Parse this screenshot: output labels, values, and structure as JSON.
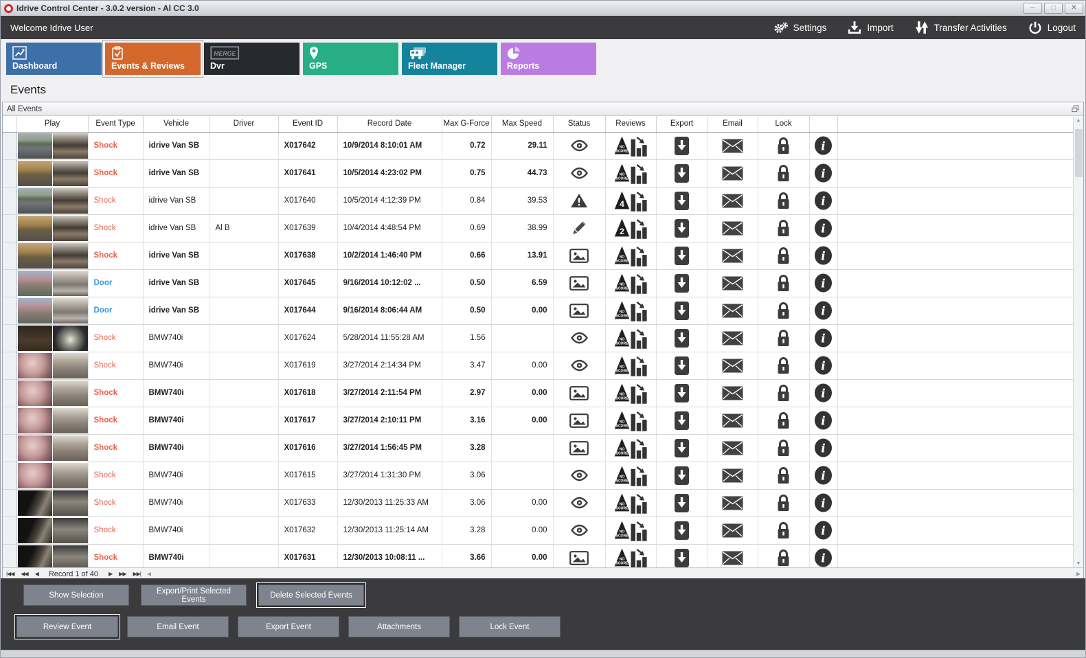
{
  "window": {
    "title": "Idrive Control Center - 3.0.2 version - Al CC 3.0",
    "controls": [
      {
        "name": "minimize"
      },
      {
        "name": "maximize"
      },
      {
        "name": "close"
      }
    ]
  },
  "topbar": {
    "welcome": "Welcome Idrive User",
    "actions": [
      {
        "name": "settings",
        "icon": "gears",
        "label": "Settings"
      },
      {
        "name": "import",
        "icon": "import",
        "label": "Import"
      },
      {
        "name": "transfer-activities",
        "icon": "transfer",
        "label": "Transfer Activities"
      },
      {
        "name": "logout",
        "icon": "power",
        "label": "Logout"
      }
    ]
  },
  "tabs": [
    {
      "name": "dashboard",
      "label": "Dashboard",
      "color": "#3d6fa8",
      "icon": "chart",
      "selected": false
    },
    {
      "name": "events-reviews",
      "label": "Events & Reviews",
      "color": "#d4682c",
      "icon": "clipboard",
      "selected": true
    },
    {
      "name": "dvr",
      "label": "Dvr",
      "color": "#26292d",
      "icon": "merge",
      "selected": false
    },
    {
      "name": "gps",
      "label": "GPS",
      "color": "#27ae85",
      "icon": "pin",
      "selected": false
    },
    {
      "name": "fleet-manager",
      "label": "Fleet Manager",
      "color": "#13849b",
      "icon": "fleet",
      "selected": false
    },
    {
      "name": "reports",
      "label": "Reports",
      "color": "#bb7ce2",
      "icon": "pie",
      "selected": false
    }
  ],
  "page": {
    "title": "Events",
    "panel_title": "All Events"
  },
  "table": {
    "columns": [
      "",
      "Play",
      "Event Type",
      "Vehicle",
      "Driver",
      "Event ID",
      "Record Date",
      "Max G-Force",
      "Max Speed",
      "Status",
      "Reviews",
      "Export",
      "Email",
      "Lock",
      ""
    ],
    "event_type_colors": {
      "Shock": "#e8614c",
      "Door": "#3a99dc"
    },
    "rows": [
      {
        "event_type": "Shock",
        "bold": true,
        "vehicle": "idrive Van SB",
        "driver": "",
        "event_id": "X017642",
        "record_date": "10/9/2014 8:10:01 AM",
        "max_g_force": "0.72",
        "max_speed": "29.11",
        "status": "viewed",
        "review": "NO SCORE",
        "thumb": "road"
      },
      {
        "event_type": "Shock",
        "bold": true,
        "vehicle": "idrive Van SB",
        "driver": "",
        "event_id": "X017641",
        "record_date": "10/5/2014 4:23:02 PM",
        "max_g_force": "0.75",
        "max_speed": "44.73",
        "status": "viewed",
        "review": "NO SCORE",
        "thumb": "autumn"
      },
      {
        "event_type": "Shock",
        "bold": false,
        "vehicle": "idrive Van SB",
        "driver": "",
        "event_id": "X017640",
        "record_date": "10/5/2014 4:12:39 PM",
        "max_g_force": "0.84",
        "max_speed": "39.53",
        "status": "warning",
        "review": "4",
        "thumb": "road"
      },
      {
        "event_type": "Shock",
        "bold": false,
        "vehicle": "idrive Van SB",
        "driver": "Al B",
        "event_id": "X017639",
        "record_date": "10/4/2014 4:48:54 PM",
        "max_g_force": "0.69",
        "max_speed": "38.99",
        "status": "edited",
        "review": "2",
        "thumb": "autumn"
      },
      {
        "event_type": "Shock",
        "bold": true,
        "vehicle": "idrive Van SB",
        "driver": "",
        "event_id": "X017638",
        "record_date": "10/2/2014 1:46:40 PM",
        "max_g_force": "0.66",
        "max_speed": "13.91",
        "status": "snapshot",
        "review": "NO SCORE",
        "thumb": "autumn"
      },
      {
        "event_type": "Door",
        "bold": true,
        "vehicle": "idrive Van SB",
        "driver": "",
        "event_id": "X017645",
        "record_date": "9/16/2014 10:12:02 ...",
        "max_g_force": "0.50",
        "max_speed": "6.59",
        "status": "snapshot",
        "review": "NO SCORE",
        "thumb": "trees"
      },
      {
        "event_type": "Door",
        "bold": true,
        "vehicle": "idrive Van SB",
        "driver": "",
        "event_id": "X017644",
        "record_date": "9/16/2014 8:06:44 AM",
        "max_g_force": "0.50",
        "max_speed": "0.00",
        "status": "snapshot",
        "review": "NO SCORE",
        "thumb": "trees"
      },
      {
        "event_type": "Shock",
        "bold": false,
        "vehicle": "BMW740i",
        "driver": "",
        "event_id": "X017624",
        "record_date": "5/28/2014 11:55:28 AM",
        "max_g_force": "1.56",
        "max_speed": "",
        "status": "viewed",
        "review": "NO SCORE",
        "thumb": "darkroom"
      },
      {
        "event_type": "Shock",
        "bold": false,
        "vehicle": "BMW740i",
        "driver": "",
        "event_id": "X017619",
        "record_date": "3/27/2014 2:14:34 PM",
        "max_g_force": "3.47",
        "max_speed": "0.00",
        "status": "viewed",
        "review": "NO SCORE",
        "thumb": "pink"
      },
      {
        "event_type": "Shock",
        "bold": true,
        "vehicle": "BMW740i",
        "driver": "",
        "event_id": "X017618",
        "record_date": "3/27/2014 2:11:54 PM",
        "max_g_force": "2.97",
        "max_speed": "0.00",
        "status": "snapshot",
        "review": "NO SCORE",
        "thumb": "pink"
      },
      {
        "event_type": "Shock",
        "bold": true,
        "vehicle": "BMW740i",
        "driver": "",
        "event_id": "X017617",
        "record_date": "3/27/2014 2:10:11 PM",
        "max_g_force": "3.16",
        "max_speed": "0.00",
        "status": "snapshot",
        "review": "NO SCORE",
        "thumb": "pink"
      },
      {
        "event_type": "Shock",
        "bold": true,
        "vehicle": "BMW740i",
        "driver": "",
        "event_id": "X017616",
        "record_date": "3/27/2014 1:56:45 PM",
        "max_g_force": "3.28",
        "max_speed": "",
        "status": "snapshot",
        "review": "NO SCORE",
        "thumb": "pink"
      },
      {
        "event_type": "Shock",
        "bold": false,
        "vehicle": "BMW740i",
        "driver": "",
        "event_id": "X017615",
        "record_date": "3/27/2014 1:31:30 PM",
        "max_g_force": "3.06",
        "max_speed": "",
        "status": "viewed",
        "review": "NO SCORE",
        "thumb": "pink"
      },
      {
        "event_type": "Shock",
        "bold": false,
        "vehicle": "BMW740i",
        "driver": "",
        "event_id": "X017633",
        "record_date": "12/30/2013 11:25:33 AM",
        "max_g_force": "3.06",
        "max_speed": "0.00",
        "status": "viewed",
        "review": "NO SCORE",
        "thumb": "dim"
      },
      {
        "event_type": "Shock",
        "bold": false,
        "vehicle": "BMW740i",
        "driver": "",
        "event_id": "X017632",
        "record_date": "12/30/2013 11:25:14 AM",
        "max_g_force": "3.28",
        "max_speed": "0.00",
        "status": "viewed",
        "review": "NO SCORE",
        "thumb": "dim"
      },
      {
        "event_type": "Shock",
        "bold": true,
        "vehicle": "BMW740i",
        "driver": "",
        "event_id": "X017631",
        "record_date": "12/30/2013 10:08:11 ...",
        "max_g_force": "3.66",
        "max_speed": "0.00",
        "status": "snapshot",
        "review": "NO SCORE",
        "thumb": "dim"
      }
    ]
  },
  "pagination": {
    "label": "Record 1 of 40",
    "buttons_left": [
      "first",
      "fast-prev",
      "prev"
    ],
    "buttons_right": [
      "next",
      "fast-next",
      "last"
    ]
  },
  "footer": {
    "selection_buttons": [
      {
        "label": "Show Selection",
        "focused": false
      },
      {
        "label": "Export/Print Selected Events",
        "focused": false
      },
      {
        "label": "Delete Selected  Events",
        "focused": true
      }
    ],
    "event_buttons": [
      {
        "label": "Review Event",
        "focused": true
      },
      {
        "label": "Email Event",
        "focused": false
      },
      {
        "label": "Export Event",
        "focused": false
      },
      {
        "label": "Attachments",
        "focused": false
      },
      {
        "label": "Lock Event",
        "focused": false
      }
    ]
  }
}
